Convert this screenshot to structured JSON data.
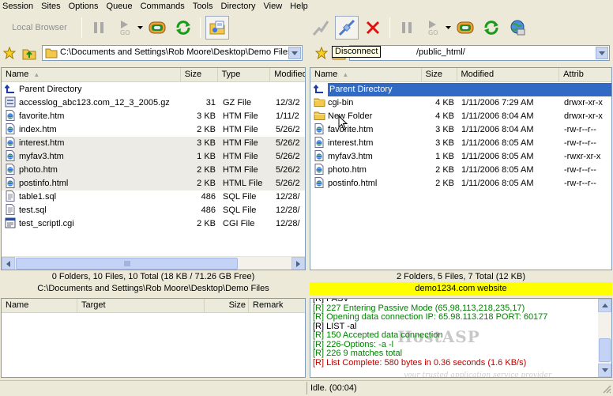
{
  "menu": [
    "Session",
    "Sites",
    "Options",
    "Queue",
    "Commands",
    "Tools",
    "Directory",
    "View",
    "Help"
  ],
  "left_toolbar": {
    "local_browser_label": "Local Browser"
  },
  "tooltip": "Disconnect",
  "left_address": "C:\\Documents and Settings\\Rob Moore\\Desktop\\Demo Files",
  "right_address": "/public_html/",
  "left_columns": [
    "Name",
    "Size",
    "Type",
    "Modified"
  ],
  "right_columns": [
    "Name",
    "Size",
    "Modified",
    "Attrib"
  ],
  "left_files": [
    {
      "name": "Parent Directory",
      "size": "",
      "type": "",
      "modified": "",
      "icon": "parent-dir-icon"
    },
    {
      "name": "accesslog_abc123.com_12_3_2005.gz",
      "size": "31",
      "type": "GZ File",
      "modified": "12/3/2",
      "icon": "archive-file-icon"
    },
    {
      "name": "favorite.htm",
      "size": "3 KB",
      "type": "HTM File",
      "modified": "1/11/2",
      "icon": "html-file-icon"
    },
    {
      "name": "index.htm",
      "size": "2 KB",
      "type": "HTM File",
      "modified": "5/26/2",
      "icon": "html-file-icon"
    },
    {
      "name": "interest.htm",
      "size": "3 KB",
      "type": "HTM File",
      "modified": "5/26/2",
      "icon": "html-file-icon"
    },
    {
      "name": "myfav3.htm",
      "size": "1 KB",
      "type": "HTM File",
      "modified": "5/26/2",
      "icon": "html-file-icon"
    },
    {
      "name": "photo.htm",
      "size": "2 KB",
      "type": "HTM File",
      "modified": "5/26/2",
      "icon": "html-file-icon"
    },
    {
      "name": "postinfo.html",
      "size": "2 KB",
      "type": "HTML File",
      "modified": "5/26/2",
      "icon": "html-file-icon"
    },
    {
      "name": "table1.sql",
      "size": "486",
      "type": "SQL File",
      "modified": "12/28/",
      "icon": "text-file-icon"
    },
    {
      "name": "test.sql",
      "size": "486",
      "type": "SQL File",
      "modified": "12/28/",
      "icon": "text-file-icon"
    },
    {
      "name": "test_scriptl.cgi",
      "size": "2 KB",
      "type": "CGI File",
      "modified": "12/28/",
      "icon": "cgi-file-icon"
    }
  ],
  "right_files": [
    {
      "name": "Parent Directory",
      "size": "",
      "modified": "",
      "attrib": "",
      "icon": "parent-dir-icon"
    },
    {
      "name": "cgi-bin",
      "size": "4 KB",
      "modified": "1/11/2006 7:29 AM",
      "attrib": "drwxr-xr-x",
      "icon": "folder-icon"
    },
    {
      "name": "New Folder",
      "size": "4 KB",
      "modified": "1/11/2006 8:04 AM",
      "attrib": "drwxr-xr-x",
      "icon": "folder-icon"
    },
    {
      "name": "favorite.htm",
      "size": "3 KB",
      "modified": "1/11/2006 8:04 AM",
      "attrib": "-rw-r--r--",
      "icon": "html-file-icon"
    },
    {
      "name": "interest.htm",
      "size": "3 KB",
      "modified": "1/11/2006 8:05 AM",
      "attrib": "-rw-r--r--",
      "icon": "html-file-icon"
    },
    {
      "name": "myfav3.htm",
      "size": "1 KB",
      "modified": "1/11/2006 8:05 AM",
      "attrib": "-rwxr-xr-x",
      "icon": "html-file-icon"
    },
    {
      "name": "photo.htm",
      "size": "2 KB",
      "modified": "1/11/2006 8:05 AM",
      "attrib": "-rw-r--r--",
      "icon": "html-file-icon"
    },
    {
      "name": "postinfo.html",
      "size": "2 KB",
      "modified": "1/11/2006 8:05 AM",
      "attrib": "-rw-r--r--",
      "icon": "html-file-icon"
    }
  ],
  "left_status": "0 Folders, 10 Files, 10 Total (18 KB / 71.26 GB Free)",
  "left_path_status": "C:\\Documents and Settings\\Rob Moore\\Desktop\\Demo Files",
  "right_status": "2 Folders, 5 Files, 7 Total (12 KB)",
  "right_site_status": "demo1234.com website",
  "queue_columns": [
    "Name",
    "Target",
    "Size",
    "Remark"
  ],
  "log": [
    {
      "text": "[R] PASV",
      "color": "black"
    },
    {
      "text": "[R] 227 Entering Passive Mode (65,98,113,218,235,17)",
      "color": "green"
    },
    {
      "text": "[R] Opening data connection IP: 65.98.113.218 PORT: 60177",
      "color": "green"
    },
    {
      "text": "[R] LIST -al",
      "color": "black"
    },
    {
      "text": "[R] 150 Accepted data connection",
      "color": "green"
    },
    {
      "text": "[R] 226-Options: -a -l",
      "color": "green"
    },
    {
      "text": "[R] 226 9 matches total",
      "color": "green"
    },
    {
      "text": "[R] List Complete: 580 bytes in 0.36 seconds (1.6 KB/s)",
      "color": "red"
    }
  ],
  "watermark": "HostASP",
  "watermark_sub": "your trusted application service provider",
  "status_bar": "Idle. (00:04)",
  "colors": {
    "site_status_bg": "#ffff00",
    "selection": "#316ac5",
    "log_green": "#008000",
    "log_red": "#c00000"
  }
}
